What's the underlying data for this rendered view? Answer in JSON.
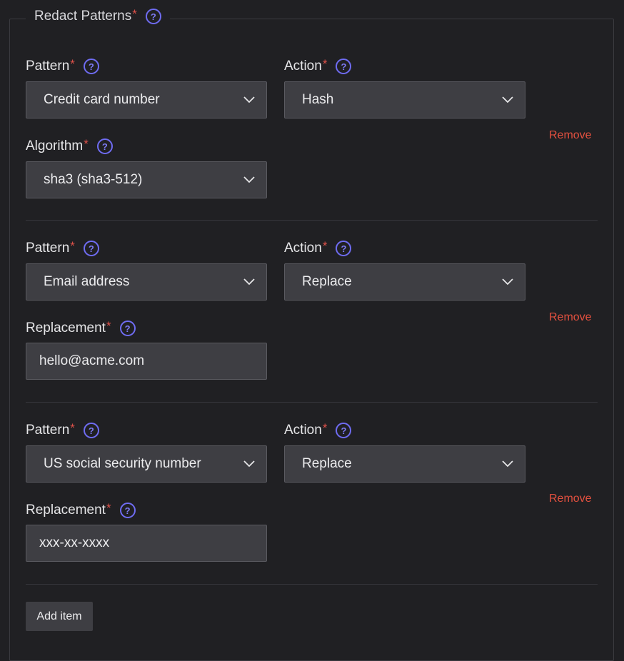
{
  "section": {
    "title": "Redact Patterns",
    "required_mark": "*",
    "help_glyph": "?"
  },
  "items": [
    {
      "pattern_label": "Pattern",
      "pattern_value": "Credit card number",
      "action_label": "Action",
      "action_value": "Hash",
      "extra_label": "Algorithm",
      "extra_value": "sha3 (sha3-512)",
      "remove_label": "Remove"
    },
    {
      "pattern_label": "Pattern",
      "pattern_value": "Email address",
      "action_label": "Action",
      "action_value": "Replace",
      "extra_label": "Replacement",
      "extra_value": "hello@acme.com",
      "remove_label": "Remove"
    },
    {
      "pattern_label": "Pattern",
      "pattern_value": "US social security number",
      "action_label": "Action",
      "action_value": "Replace",
      "extra_label": "Replacement",
      "extra_value": "xxx-xx-xxxx",
      "remove_label": "Remove"
    }
  ],
  "add_item_label": "Add item",
  "icons": {
    "help": "help-circle-icon",
    "chevron": "chevron-down-icon"
  },
  "colors": {
    "background": "#202023",
    "field": "#3e3e43",
    "accent": "#6f6cf2",
    "required": "#e0524a",
    "remove": "#e2503f"
  }
}
